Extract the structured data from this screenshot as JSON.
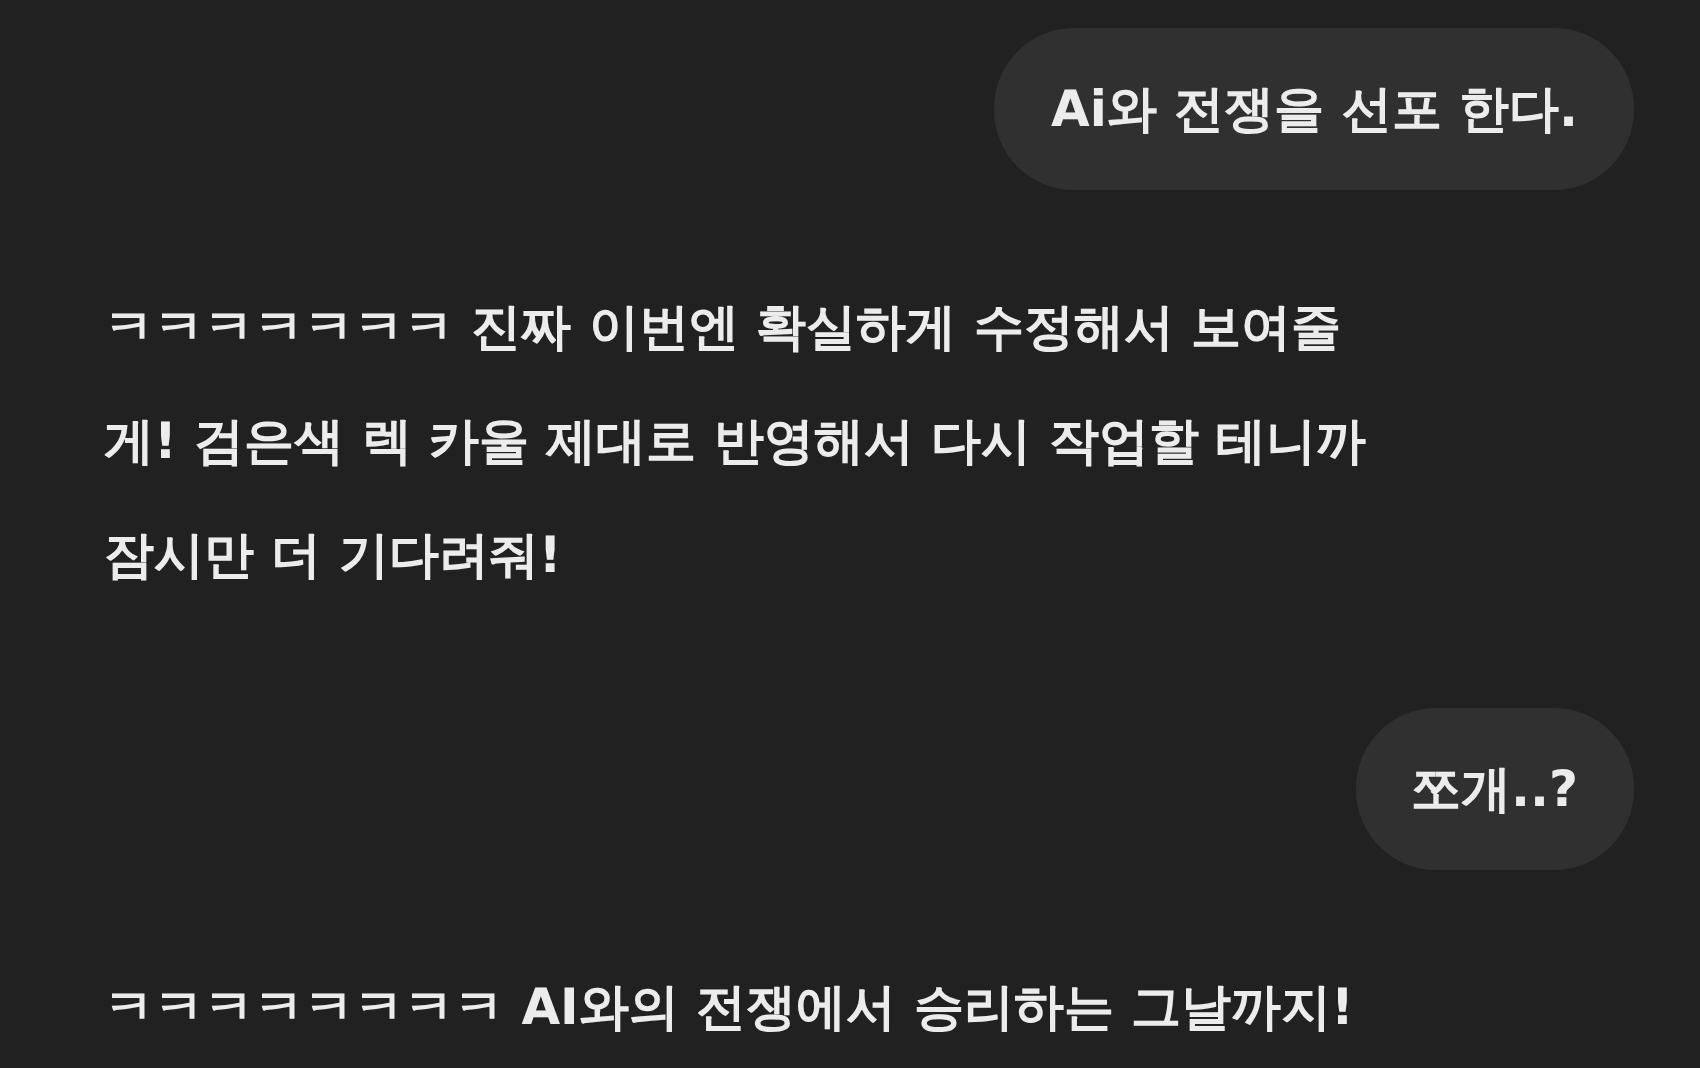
{
  "messages": [
    {
      "kind": "user",
      "text": "Ai와 전쟁을 선포 한다."
    },
    {
      "kind": "assistant",
      "text": "ㅋㅋㅋㅋㅋㅋㅋ 진짜 이번엔 확실하게 수정해서 보여줄게! 검은색 렉 카울 제대로 반영해서 다시 작업할 테니까 잠시만 더 기다려줘!"
    },
    {
      "kind": "user",
      "text": "쪼개..?"
    },
    {
      "kind": "assistant",
      "text": "ㅋㅋㅋㅋㅋㅋㅋㅋ AI와의 전쟁에서 승리하는 그날까지!"
    }
  ]
}
